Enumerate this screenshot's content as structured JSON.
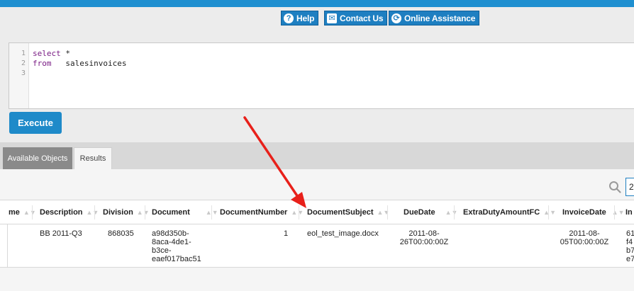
{
  "help_bar": {
    "help": "Help",
    "contact": "Contact Us",
    "online": "Online Assistance"
  },
  "editor": {
    "line_numbers": [
      "1",
      "2",
      "3"
    ],
    "lines": [
      {
        "kw": "select",
        "rest": " *"
      },
      {
        "kw": "from",
        "rest": "   salesinvoices"
      },
      {
        "kw": "",
        "rest": ""
      }
    ]
  },
  "execute_label": "Execute",
  "tabs": {
    "objects": "Available Objects",
    "results": "Results"
  },
  "page_size_value": "2",
  "grid": {
    "columns": [
      "me",
      "Description",
      "Division",
      "Document",
      "DocumentNumber",
      "DocumentSubject",
      "DueDate",
      "ExtraDutyAmountFC",
      "InvoiceDate",
      "In"
    ],
    "row": {
      "description": "BB 2011-Q3",
      "division": "868035",
      "document_lines": [
        "a98d350b-",
        "8aca-4de1-",
        "b3ce-",
        "eaef017bac51"
      ],
      "document_number": "1",
      "document_subject": "eol_test_image.docx",
      "due_date_lines": [
        "2011-08-",
        "26T00:00:00Z"
      ],
      "extra_duty": "",
      "invoice_date_lines": [
        "2011-08-",
        "05T00:00:00Z"
      ],
      "in_lines": [
        "61",
        "f4",
        "b7",
        "e7"
      ]
    }
  },
  "colors": {
    "accent": "#1f8fd0",
    "arrow": "#e8201a"
  }
}
